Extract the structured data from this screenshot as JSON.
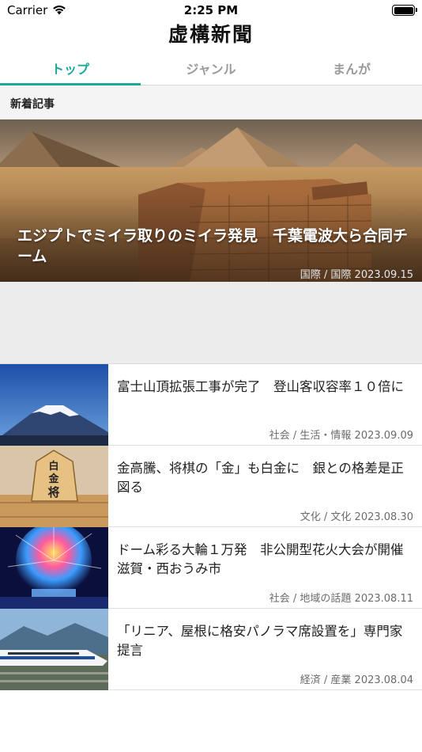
{
  "status_bar": {
    "carrier": "Carrier",
    "time": "2:25 PM"
  },
  "header": {
    "logo": "虚構新聞"
  },
  "tabs": [
    {
      "label": "トップ",
      "active": true
    },
    {
      "label": "ジャンル",
      "active": false
    },
    {
      "label": "まんが",
      "active": false
    }
  ],
  "section": {
    "title": "新着記事"
  },
  "featured": {
    "title": "エジプトでミイラ取りのミイラ発見　千葉電波大ら合同チーム",
    "meta": "国際 / 国際 2023.09.15"
  },
  "articles": [
    {
      "title": "富士山頂拡張工事が完了　登山客収容率１０倍に",
      "meta": "社会 / 生活・情報 2023.09.09",
      "thumb": "mountain"
    },
    {
      "title": "金高騰、将棋の「金」も白金に　銀との格差是正図る",
      "meta": "文化 / 文化 2023.08.30",
      "thumb": "shogi-piece"
    },
    {
      "title": "ドーム彩る大輪１万発　非公開型花火大会が開催　滋賀・西おうみ市",
      "meta": "社会 / 地域の話題 2023.08.11",
      "thumb": "fireworks"
    },
    {
      "title": "「リニア、屋根に格安パノラマ席設置を」専門家提言",
      "meta": "経済 / 産業 2023.08.04",
      "thumb": "bullet-train"
    }
  ],
  "shogi_piece_text": "白金将",
  "colors": {
    "accent": "#1aa89b",
    "tab_inactive": "#9a9a9a",
    "section_bg": "#f4f4f4"
  }
}
